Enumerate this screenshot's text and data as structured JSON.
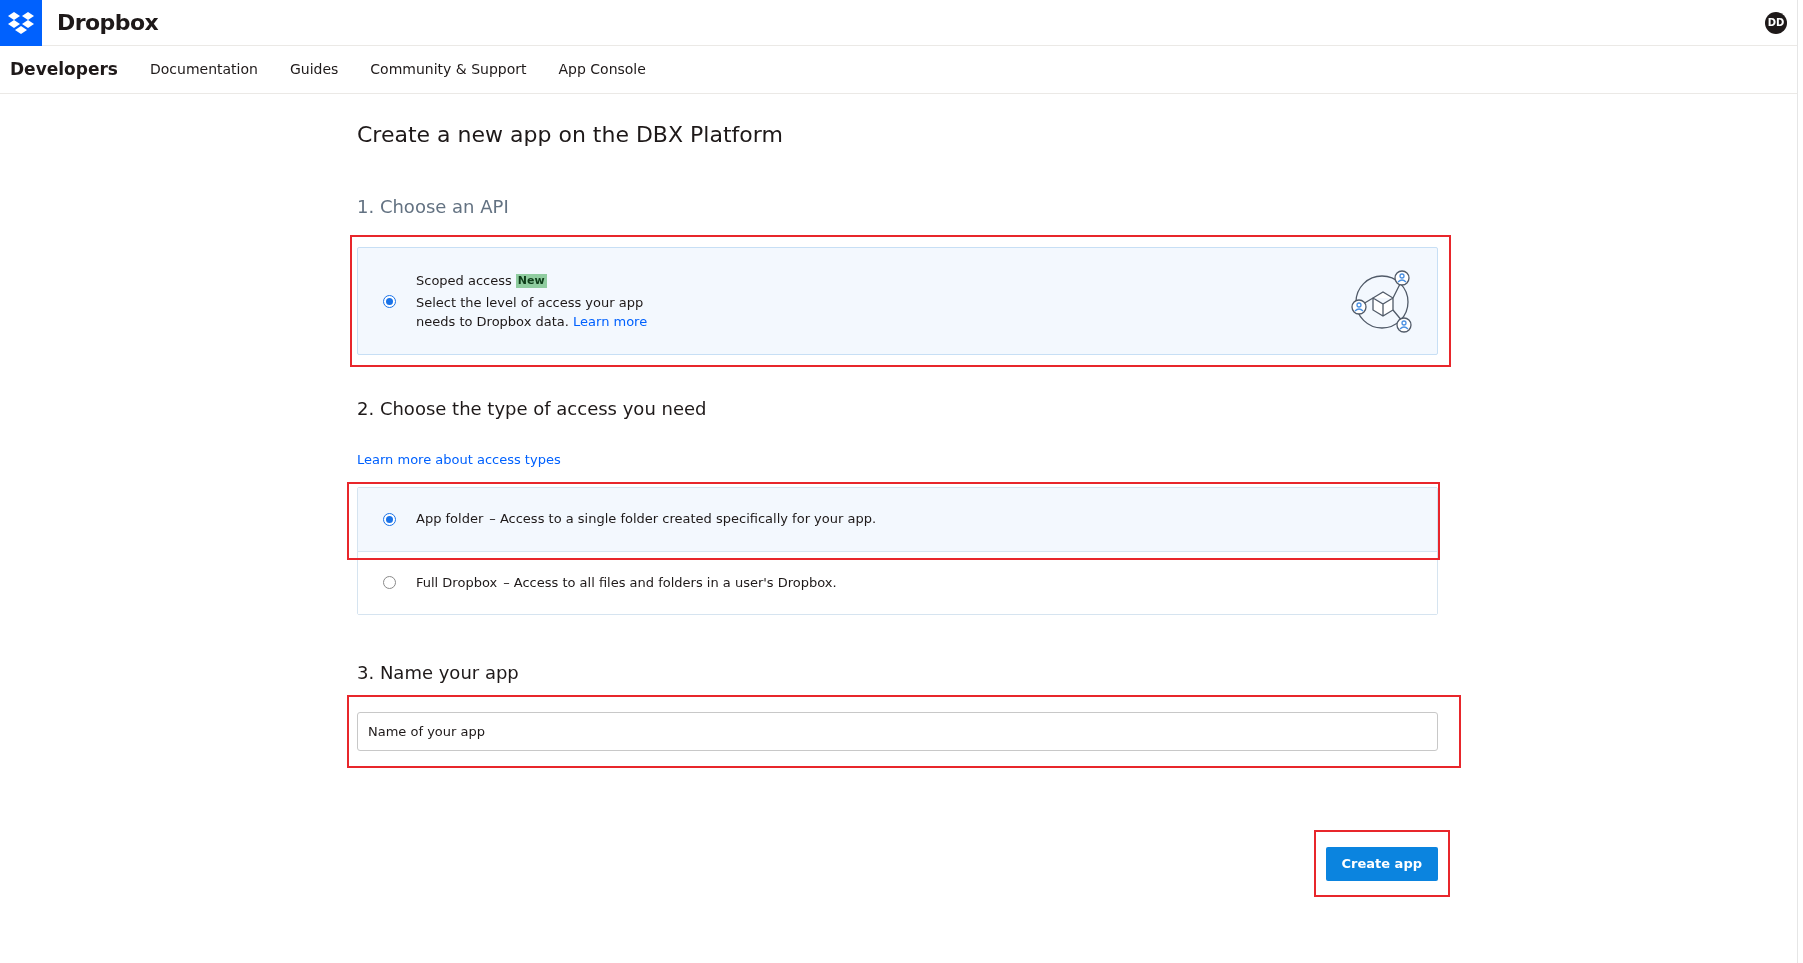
{
  "header": {
    "brand": "Dropbox",
    "avatar": "DD"
  },
  "nav": {
    "title": "Developers",
    "items": [
      "Documentation",
      "Guides",
      "Community & Support",
      "App Console"
    ]
  },
  "page_title": "Create a new app on the DBX Platform",
  "api_section": {
    "heading": "1. Choose an API",
    "highlighted": true,
    "options": [
      {
        "title": "Scoped access",
        "badge": "New",
        "description": "Select the level of access your app needs to Dropbox data.",
        "link": "Learn more",
        "selected": true
      }
    ]
  },
  "access_section": {
    "heading": "2. Choose the type of access you need",
    "link": "Learn more about access types",
    "options": [
      {
        "title": "App folder",
        "description": "– Access to a single folder created specifically for your app.",
        "selected": true,
        "highlighted": true
      },
      {
        "title": "Full Dropbox",
        "description": "– Access to all files and folders in a user's Dropbox.",
        "selected": false,
        "highlighted": false
      }
    ]
  },
  "name_section": {
    "heading": "3. Name your app",
    "placeholder": "Name of your app",
    "highlighted": true
  },
  "create_button": {
    "label": "Create app",
    "highlighted": true
  }
}
